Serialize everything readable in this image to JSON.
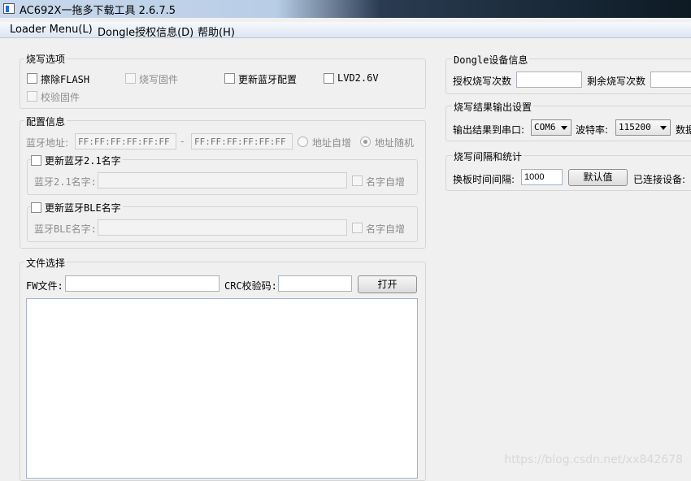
{
  "window": {
    "title": "AC692X一拖多下载工具 2.6.7.5"
  },
  "menu": {
    "items": [
      "Loader Menu(L)",
      "Dongle授权信息(D)",
      "帮助(H)"
    ]
  },
  "burn_options": {
    "title": "烧写选项",
    "erase_flash": "擦除FLASH",
    "burn_firmware": "烧写固件",
    "update_bt_config": "更新蓝牙配置",
    "lvd": "LVD2.6V",
    "verify_firmware": "校验固件"
  },
  "config": {
    "title": "配置信息",
    "bt_address_label": "蓝牙地址:",
    "addr_start_placeholder": "FF:FF:FF:FF:FF:FF",
    "dash": "-",
    "addr_end_placeholder": "FF:FF:FF:FF:FF:FF",
    "addr_auto_inc": "地址自增",
    "addr_random": "地址随机",
    "bt21": {
      "checkbox": "更新蓝牙2.1名字",
      "label": "蓝牙2.1名字:",
      "auto_inc": "名字自增"
    },
    "ble": {
      "checkbox": "更新蓝牙BLE名字",
      "label": "蓝牙BLE名字:",
      "auto_inc": "名字自增"
    }
  },
  "file_select": {
    "title": "文件选择",
    "fw_label": "FW文件:",
    "crc_label": "CRC校验码:",
    "open_button": "打开"
  },
  "dongle": {
    "title": "Dongle设备信息",
    "auth_count_label": "授权烧写次数",
    "remaining_label": "剩余烧写次数"
  },
  "output": {
    "title": "烧写结果输出设置",
    "serial_label": "输出结果到串口:",
    "port": "COM6",
    "baud_label": "波特率:",
    "baud": "115200",
    "data_label": "数据"
  },
  "interval": {
    "title": "烧写间隔和统计",
    "interval_label": "换板时间间隔:",
    "interval_value": "1000",
    "default_button": "默认值",
    "connected_label": "已连接设备:"
  },
  "watermark": "https://blog.csdn.net/xx842678"
}
